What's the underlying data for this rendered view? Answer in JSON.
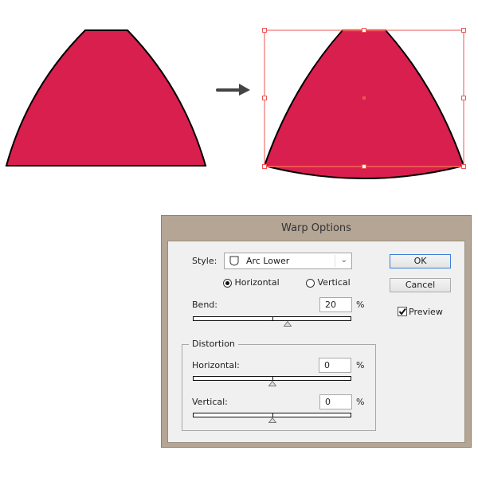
{
  "illustration": {
    "shape_fill": "#d81f4d",
    "stroke_color": "#000000",
    "selection_color": "#ef5454",
    "arrow_color": "#444444"
  },
  "dialog": {
    "title": "Warp Options",
    "style_label": "Style:",
    "style_value": "Arc Lower",
    "orientation": {
      "options": [
        "Horizontal",
        "Vertical"
      ],
      "selected": "Horizontal"
    },
    "bend": {
      "label": "Bend:",
      "value": "20",
      "unit": "%",
      "percent": 20
    },
    "distortion": {
      "title": "Distortion",
      "horizontal": {
        "label": "Horizontal:",
        "value": "0",
        "unit": "%",
        "percent": 0
      },
      "vertical": {
        "label": "Vertical:",
        "value": "0",
        "unit": "%",
        "percent": 0
      }
    },
    "ok_label": "OK",
    "cancel_label": "Cancel",
    "preview": {
      "label": "Preview",
      "checked": true
    }
  }
}
